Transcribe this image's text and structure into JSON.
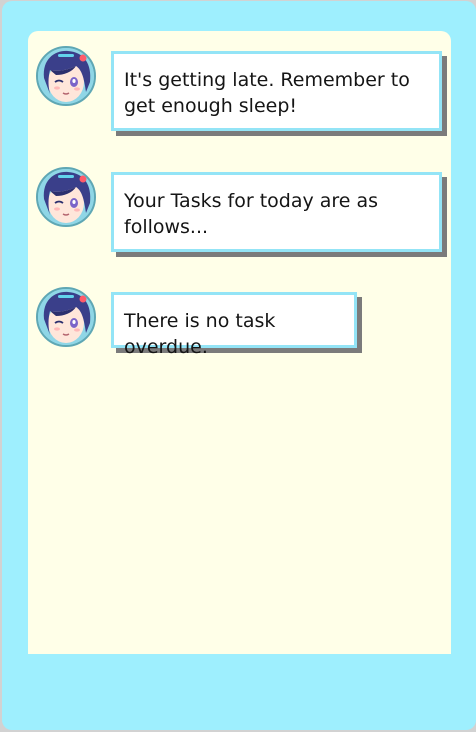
{
  "messages": [
    {
      "text": "It's getting late. Remember to get enough sleep!"
    },
    {
      "text": "Your Tasks for today are as follows..."
    },
    {
      "text": "There is no task overdue."
    }
  ],
  "colors": {
    "window": "#9eeffe",
    "panel": "#ffffe8",
    "bubble_border": "#93e4f6",
    "bubble_shadow": "#7b7b7b",
    "hair": "#3a3f8a"
  },
  "icons": {
    "avatar": "anime-girl-avatar-icon"
  }
}
